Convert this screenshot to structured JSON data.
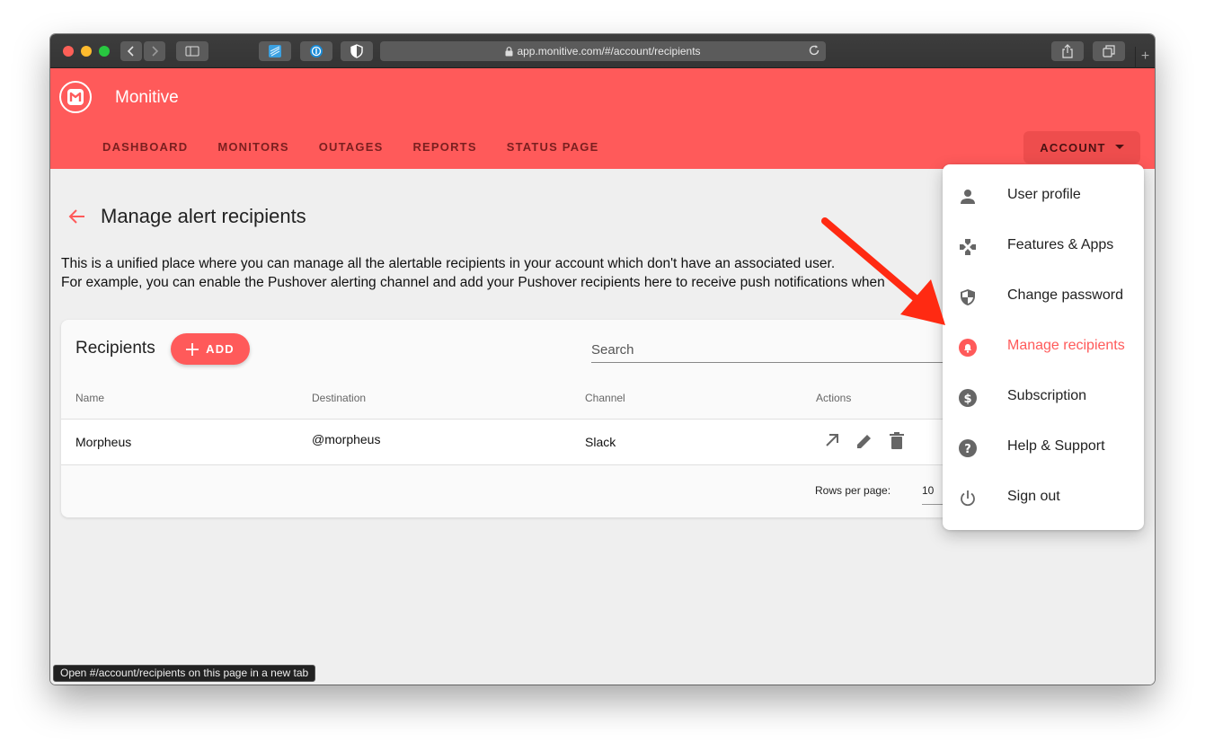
{
  "browser": {
    "url": "app.monitive.com/#/account/recipients"
  },
  "app": {
    "title": "Monitive",
    "nav": [
      "DASHBOARD",
      "MONITORS",
      "OUTAGES",
      "REPORTS",
      "STATUS PAGE"
    ],
    "account_label": "ACCOUNT"
  },
  "page": {
    "title": "Manage alert recipients",
    "description_line1": "This is a unified place where you can manage all the alertable recipients in your account which don't have an associated user.",
    "description_line2": "For example, you can enable the Pushover alerting channel and add your Pushover recipients here to receive push notifications when"
  },
  "card": {
    "title": "Recipients",
    "add_label": "ADD",
    "search_placeholder": "Search",
    "columns": {
      "name": "Name",
      "destination": "Destination",
      "channel": "Channel",
      "actions": "Actions"
    },
    "rows": [
      {
        "name": "Morpheus",
        "destination": "@morpheus",
        "channel": "Slack"
      }
    ],
    "rows_per_page_label": "Rows per page:",
    "rows_per_page_value": "10"
  },
  "menu": {
    "items": [
      {
        "label": "User profile",
        "icon": "person-icon"
      },
      {
        "label": "Features & Apps",
        "icon": "gamepad-icon"
      },
      {
        "label": "Change password",
        "icon": "shield-icon"
      },
      {
        "label": "Manage recipients",
        "icon": "bell-icon",
        "active": true
      },
      {
        "label": "Subscription",
        "icon": "dollar-icon"
      },
      {
        "label": "Help & Support",
        "icon": "help-icon"
      },
      {
        "label": "Sign out",
        "icon": "power-icon"
      }
    ]
  },
  "status_tooltip": "Open #/account/recipients on this page in a new tab",
  "colors": {
    "brand": "#ff5a5a",
    "annotation_arrow": "#ff2a12"
  }
}
